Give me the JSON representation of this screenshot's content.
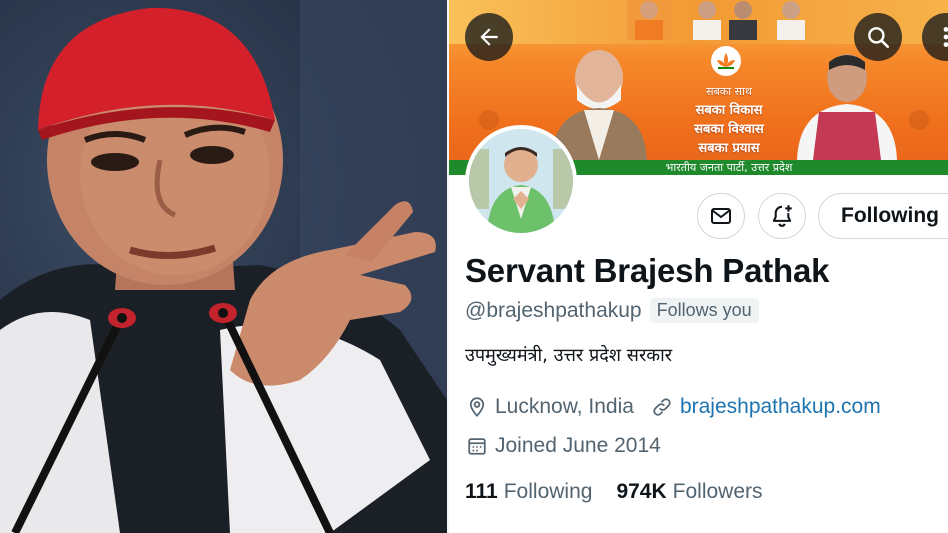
{
  "profile": {
    "display_name": "Servant Brajesh Pathak",
    "handle": "@brajeshpathakup",
    "follows_you": "Follows you",
    "bio": "उपमुख्यमंत्री, उत्तर प्रदेश सरकार",
    "location": "Lucknow, India",
    "website": "brajeshpathakup.com",
    "joined": "Joined June 2014",
    "following_count": "111",
    "following_label": "Following",
    "followers_count": "974K",
    "followers_label": "Followers"
  },
  "actions": {
    "follow_button": "Following",
    "message_icon": "mail-icon",
    "notify_icon": "bell-plus-icon"
  },
  "nav": {
    "back_icon": "arrow-left-icon",
    "search_icon": "search-icon",
    "more_icon": "more-vertical-icon"
  },
  "banner": {
    "slogans": [
      "सबका साथ",
      "सबका विकास",
      "सबका विश्वास",
      "सबका प्रयास"
    ],
    "caption": "भारतीय जनता पार्टी, उत्तर प्रदेश"
  },
  "colors": {
    "text_primary": "#0f1419",
    "text_secondary": "#536471",
    "link": "#1d74b0",
    "banner_orange": "#f0701c",
    "banner_green": "#1f8a2c"
  }
}
